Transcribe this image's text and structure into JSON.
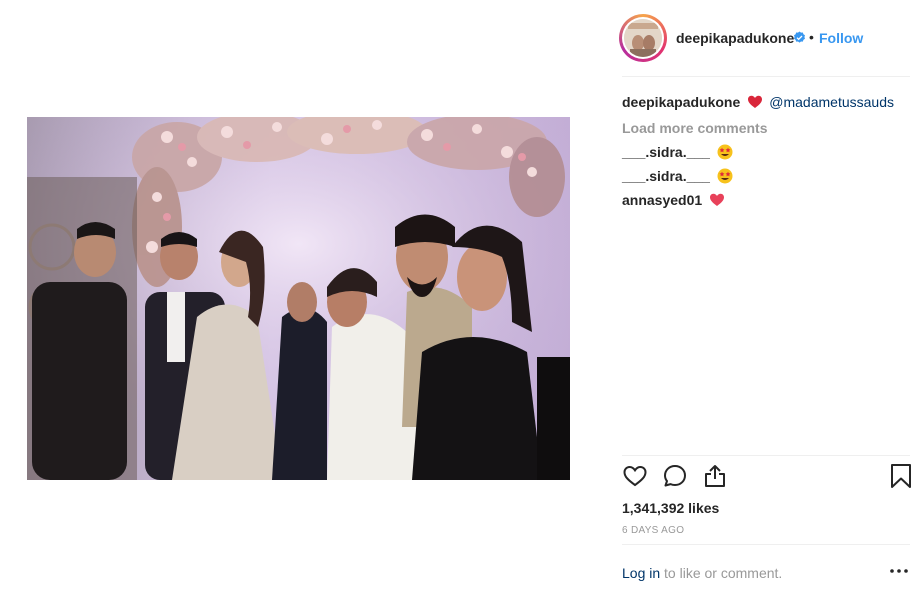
{
  "post": {
    "username": "deepikapadukone",
    "follow_separator": "•",
    "follow_label": "Follow",
    "caption_user": "deepikapadukone",
    "caption_mention": "@madametussauds",
    "load_more": "Load more comments",
    "comments": [
      {
        "user": "___.sidra.___",
        "emoji": "star-struck-emoji"
      },
      {
        "user": "___.sidra.___",
        "emoji": "star-struck-emoji"
      },
      {
        "user": "annasyed01",
        "emoji": "red-heart-emoji"
      }
    ],
    "likes": "1,341,392 likes",
    "time_ago": "6 DAYS AGO",
    "login_link": "Log in",
    "login_rest": " to like or comment."
  },
  "icons": {
    "verified": "verified-badge-icon",
    "like": "heart-outline-icon",
    "comment": "comment-bubble-icon",
    "share": "share-icon",
    "save": "bookmark-icon",
    "more": "more-options-icon"
  },
  "colors": {
    "follow": "#3897f0",
    "mention": "#003569",
    "muted": "#999999",
    "heart": "#ed4956"
  }
}
